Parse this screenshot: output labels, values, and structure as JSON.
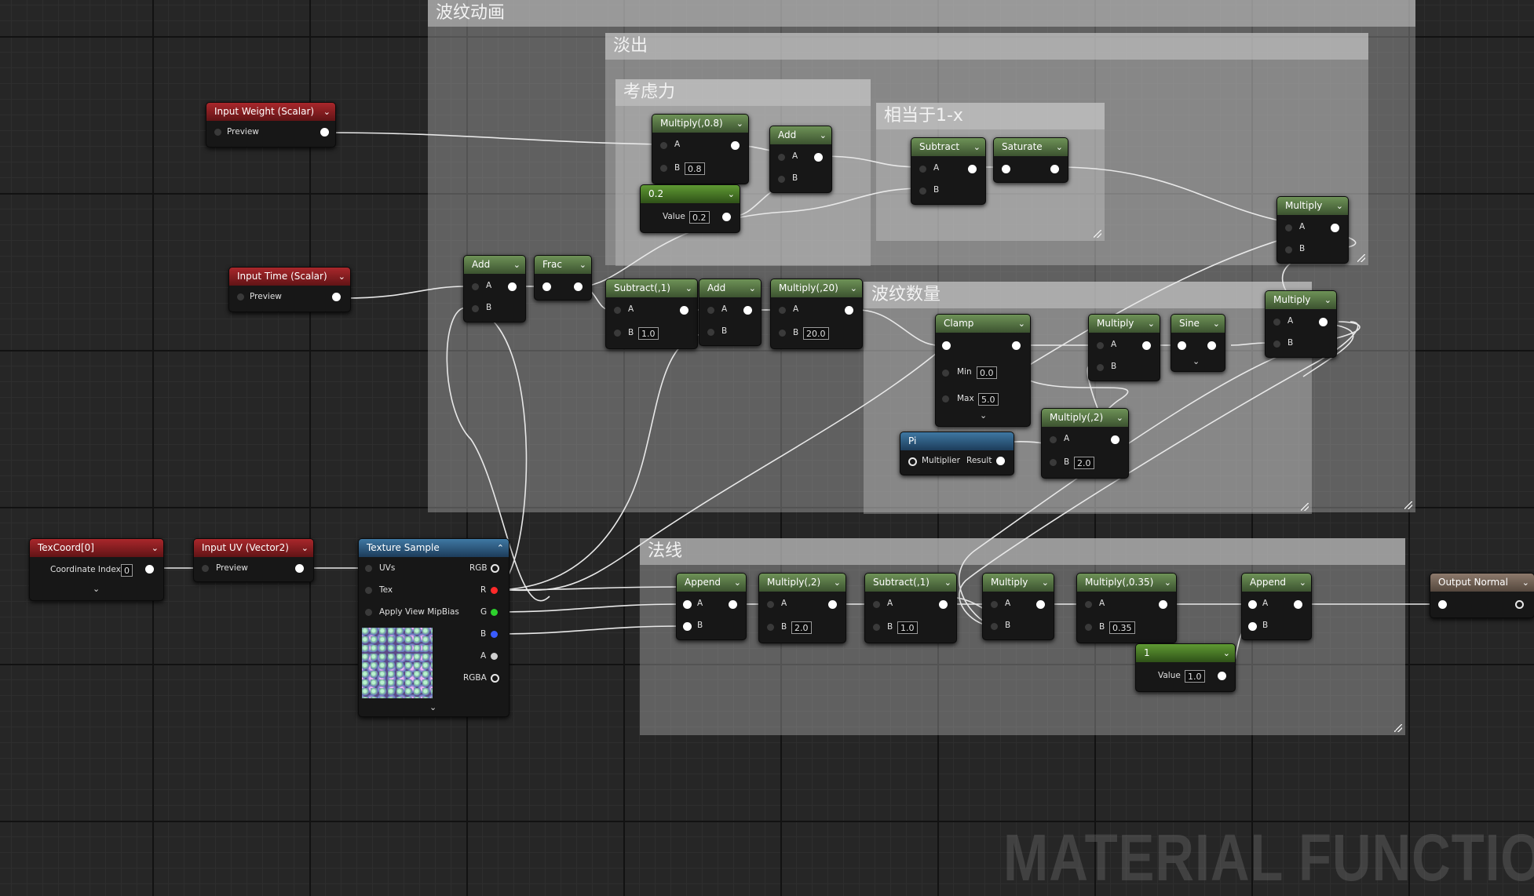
{
  "comments": {
    "ripple_anim": "波纹动画",
    "fade_out": "淡出",
    "consider_force": "考虑力",
    "equiv_one_minus_x": "相当于1-x",
    "ripple_count": "波纹数量",
    "normal": "法线"
  },
  "nodes": {
    "input_weight": {
      "title": "Input Weight (Scalar)",
      "out": "Preview"
    },
    "input_time": {
      "title": "Input Time (Scalar)",
      "out": "Preview"
    },
    "texcoord": {
      "title": "TexCoord[0]",
      "param": "Coordinate Index",
      "value": "0"
    },
    "input_uv": {
      "title": "Input UV (Vector2)",
      "out": "Preview"
    },
    "texture_sample": {
      "title": "Texture Sample",
      "in_uvs": "UVs",
      "in_tex": "Tex",
      "in_mip": "Apply View MipBias",
      "out_rgb": "RGB",
      "out_r": "R",
      "out_g": "G",
      "out_b": "B",
      "out_a": "A",
      "out_rgba": "RGBA"
    },
    "mul_08": {
      "title": "Multiply(,0.8)",
      "a": "A",
      "b": "B",
      "b_val": "0.8"
    },
    "const_02": {
      "title": "0.2",
      "label": "Value",
      "value": "0.2"
    },
    "add_force": {
      "title": "Add",
      "a": "A",
      "b": "B"
    },
    "subtract": {
      "title": "Subtract",
      "a": "A",
      "b": "B"
    },
    "saturate": {
      "title": "Saturate"
    },
    "multiply_fade": {
      "title": "Multiply",
      "a": "A",
      "b": "B"
    },
    "add_time": {
      "title": "Add",
      "a": "A",
      "b": "B"
    },
    "frac": {
      "title": "Frac"
    },
    "sub_1": {
      "title": "Subtract(,1)",
      "a": "A",
      "b": "B",
      "b_val": "1.0"
    },
    "add_2": {
      "title": "Add",
      "a": "A",
      "b": "B"
    },
    "mul_20": {
      "title": "Multiply(,20)",
      "a": "A",
      "b": "B",
      "b_val": "20.0"
    },
    "clamp": {
      "title": "Clamp",
      "min": "Min",
      "min_val": "0.0",
      "max": "Max",
      "max_val": "5.0"
    },
    "multiply_rc": {
      "title": "Multiply",
      "a": "A",
      "b": "B"
    },
    "sine": {
      "title": "Sine"
    },
    "multiply_rc2": {
      "title": "Multiply",
      "a": "A",
      "b": "B"
    },
    "mul_2_rc": {
      "title": "Multiply(,2)",
      "a": "A",
      "b": "B",
      "b_val": "2.0"
    },
    "pi": {
      "title": "Pi",
      "in": "Multiplier",
      "out": "Result"
    },
    "append1": {
      "title": "Append",
      "a": "A",
      "b": "B"
    },
    "mul_2_n": {
      "title": "Multiply(,2)",
      "a": "A",
      "b": "B",
      "b_val": "2.0"
    },
    "sub_1_n": {
      "title": "Subtract(,1)",
      "a": "A",
      "b": "B",
      "b_val": "1.0"
    },
    "multiply_n": {
      "title": "Multiply",
      "a": "A",
      "b": "B"
    },
    "mul_035": {
      "title": "Multiply(,0.35)",
      "a": "A",
      "b": "B",
      "b_val": "0.35"
    },
    "append2": {
      "title": "Append",
      "a": "A",
      "b": "B"
    },
    "const_1": {
      "title": "1",
      "label": "Value",
      "value": "1.0"
    },
    "output_normal": {
      "title": "Output Normal"
    }
  },
  "watermark": "MATERIAL FUNCTION",
  "colors": {
    "function_header": "#a9272b",
    "math_header": "#5a7d47",
    "texture_header": "#2f6a99",
    "output_header": "#7d6b5e",
    "wire": "#e8e8e8"
  }
}
